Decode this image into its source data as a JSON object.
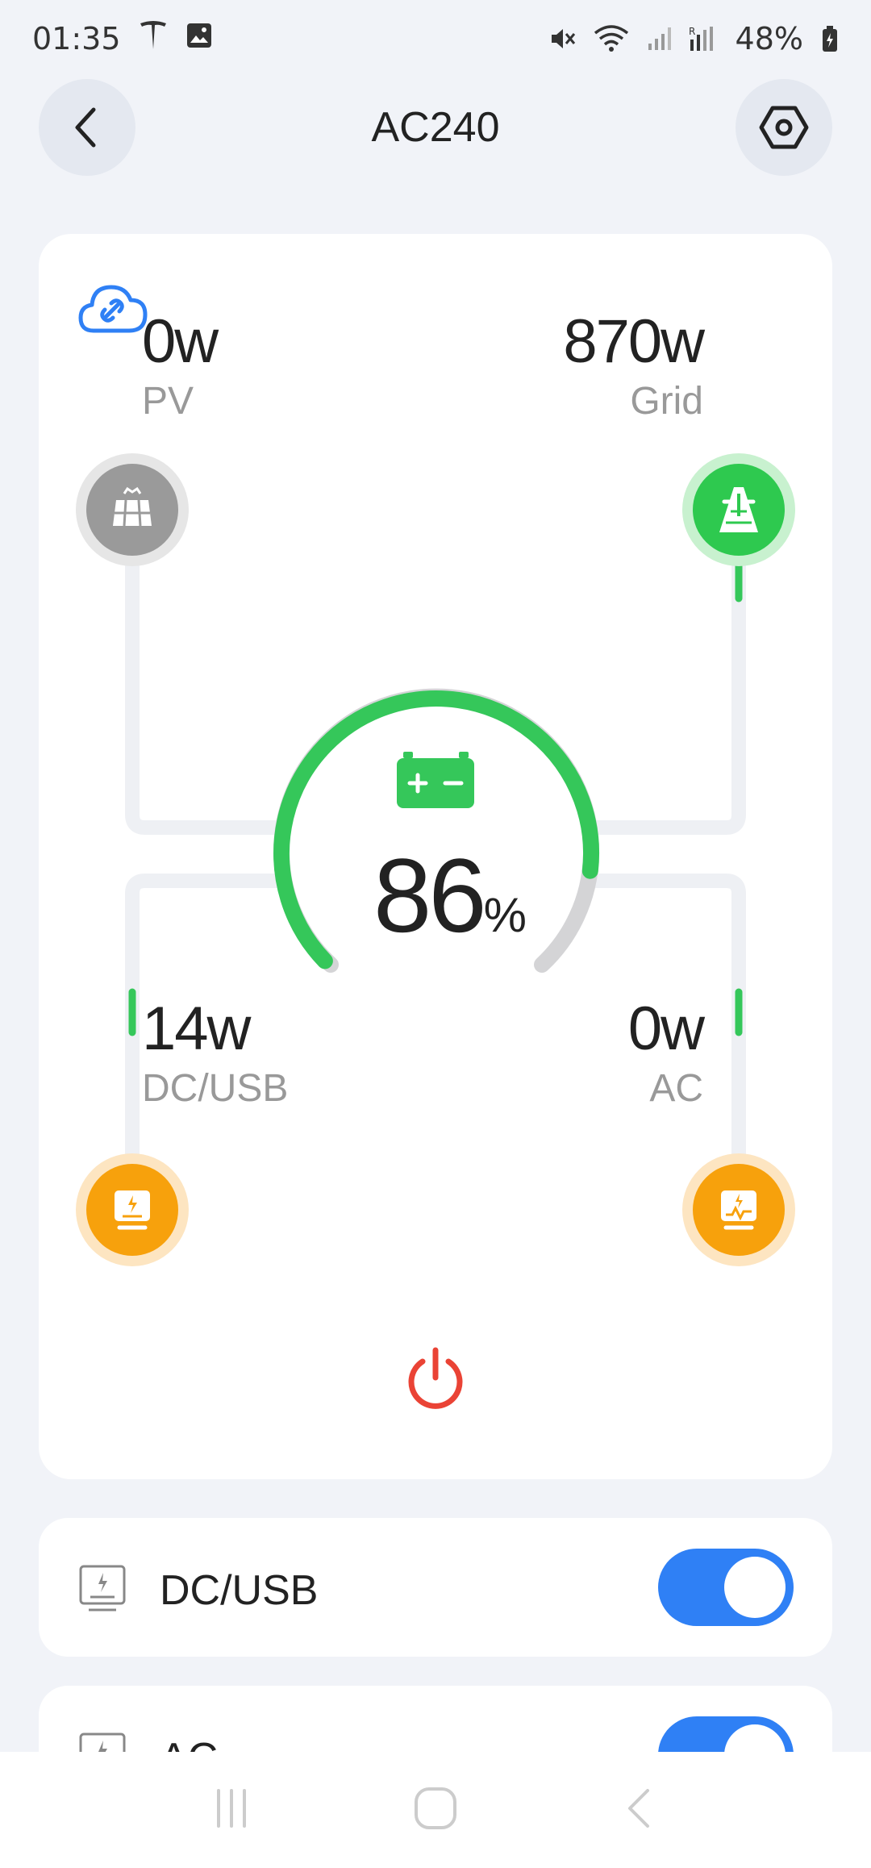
{
  "status_bar": {
    "time": "01:35",
    "battery": "48%",
    "icons": [
      "tesla-icon",
      "image-icon",
      "mute-icon",
      "wifi-icon",
      "signal-icon",
      "signal-r-icon",
      "battery-icon"
    ]
  },
  "header": {
    "title": "AC240",
    "back_icon": "chevron-left-icon",
    "settings_icon": "hexagon-settings-icon"
  },
  "energy_flow": {
    "cloud_icon": "cloud-link-icon",
    "pv": {
      "value": "0w",
      "label": "PV",
      "icon": "solar-panel-icon",
      "color": "#9a9a9a"
    },
    "grid": {
      "value": "870w",
      "label": "Grid",
      "icon": "transmission-tower-icon",
      "color": "#2ec94f"
    },
    "dc": {
      "value": "14w",
      "label": "DC/USB",
      "icon": "dc-output-icon",
      "color": "#f7a10c"
    },
    "ac": {
      "value": "0w",
      "label": "AC",
      "icon": "ac-output-icon",
      "color": "#f7a10c"
    },
    "battery": {
      "percent": "86",
      "unit": "%",
      "level": 0.86,
      "icon": "battery-icon",
      "color": "#35c75a"
    },
    "power_icon": "power-icon",
    "power_color": "#ea4335"
  },
  "outputs": [
    {
      "label": "DC/USB",
      "enabled": true,
      "icon": "dc-usb-port-icon"
    },
    {
      "label": "AC",
      "enabled": true,
      "icon": "ac-port-icon"
    }
  ],
  "colors": {
    "accent": "#2f80f5",
    "background": "#f1f3f8",
    "flow_active": "#35c75a"
  },
  "nav_bar": [
    "recent-apps-icon",
    "home-icon",
    "back-icon"
  ]
}
